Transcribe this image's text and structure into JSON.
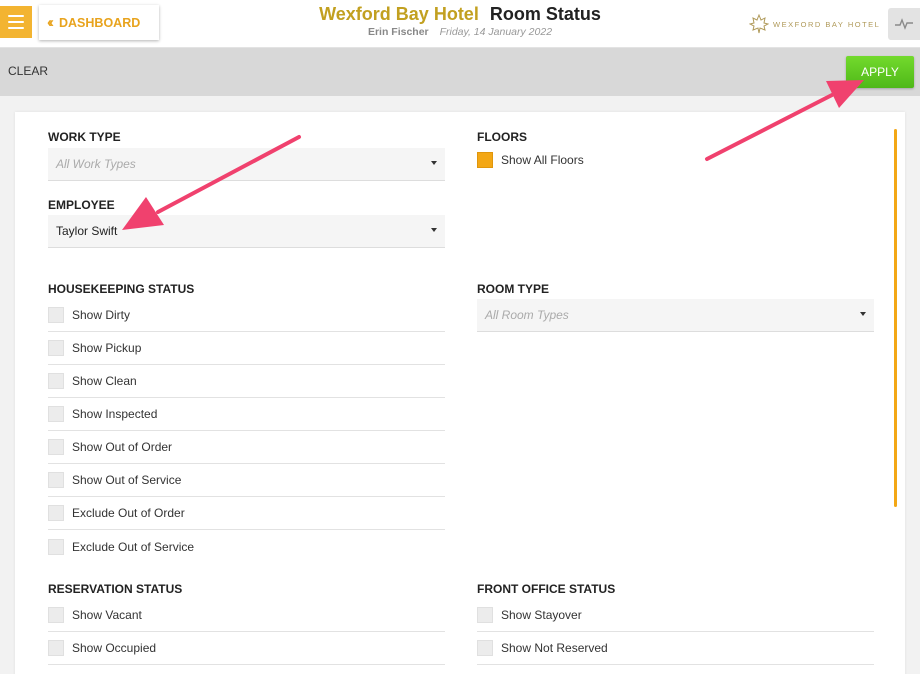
{
  "header": {
    "dashboard_label": "DASHBOARD",
    "hotel_name": "Wexford Bay Hotel",
    "page_title": "Room Status",
    "user_name": "Erin Fischer",
    "date": "Friday, 14 January 2022",
    "logo_text": "WEXFORD BAY HOTEL",
    "icons": {
      "menu": "hamburger-menu-icon",
      "back": "double-chevron-left-icon",
      "logo": "maple-leaf-icon",
      "activity": "pulse-icon"
    }
  },
  "actions": {
    "clear_label": "CLEAR",
    "apply_label": "APPLY"
  },
  "filters": {
    "work_type": {
      "label": "WORK TYPE",
      "placeholder": "All Work Types"
    },
    "floors": {
      "label": "FLOORS",
      "option": "Show All Floors",
      "checked": true
    },
    "employee": {
      "label": "EMPLOYEE",
      "value": "Taylor Swift"
    },
    "housekeeping": {
      "label": "HOUSEKEEPING STATUS",
      "options": [
        "Show Dirty",
        "Show Pickup",
        "Show Clean",
        "Show Inspected",
        "Show Out of Order",
        "Show Out of Service",
        "Exclude Out of Order",
        "Exclude Out of Service"
      ]
    },
    "room_type": {
      "label": "ROOM TYPE",
      "placeholder": "All Room Types"
    },
    "reservation": {
      "label": "RESERVATION STATUS",
      "options": [
        "Show Vacant",
        "Show Occupied"
      ]
    },
    "front_office": {
      "label": "FRONT OFFICE STATUS",
      "options": [
        "Show Stayover",
        "Show Not Reserved"
      ]
    }
  },
  "colors": {
    "accent": "#f3a715",
    "apply_green": "#5cc71f",
    "hotel_gold": "#c2a020",
    "annotation_arrow": "#f0416e"
  }
}
